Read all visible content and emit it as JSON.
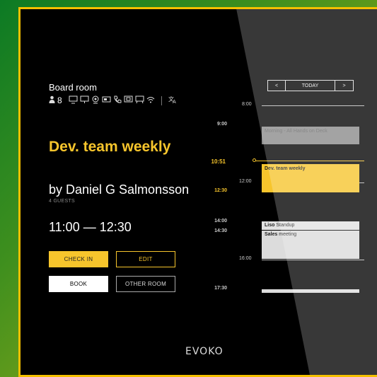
{
  "room": {
    "name": "Board room",
    "capacity": "8",
    "amenities": [
      "monitor-icon",
      "display-icon",
      "webcam-icon",
      "projector-icon",
      "phone-icon",
      "screen-share-icon",
      "whiteboard-icon",
      "wifi-icon",
      "translate-icon"
    ]
  },
  "meeting": {
    "title": "Dev. team weekly",
    "organizer": "by Daniel G Salmonsson",
    "guests": "4 GUESTS",
    "time_range": "11:00 — 12:30"
  },
  "buttons": {
    "check_in": "CHECK IN",
    "edit": "EDIT",
    "book": "BOOK",
    "other_room": "OTHER ROOM"
  },
  "time_markers": {
    "t0900": "9:00",
    "now": "10:51",
    "t1230": "12:30",
    "t1400": "14:00",
    "t1430": "14:30",
    "t1730": "17:30"
  },
  "calendar": {
    "nav_prev": "<",
    "today": "TODAY",
    "nav_next": ">",
    "hours": {
      "h0800": "8:00",
      "h1200": "12:00",
      "h1600": "16:00"
    },
    "events": {
      "past": "Morning - All Hands on Deck",
      "current": "Dev. team weekly",
      "standup_owner": "Liso",
      "standup": "Standup",
      "sales_owner": "Sales",
      "sales": "meeting"
    }
  },
  "brand": "EVOKO",
  "colors": {
    "accent": "#f7c52c",
    "background": "#000000",
    "frame": "#f4c000"
  }
}
